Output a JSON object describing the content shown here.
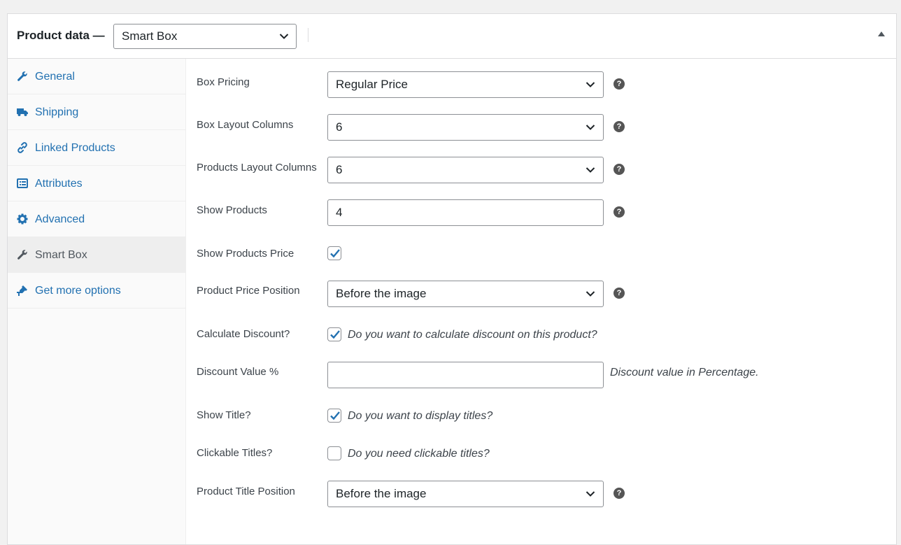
{
  "header": {
    "title": "Product data —",
    "product_type": "Smart Box"
  },
  "sidebar": {
    "items": [
      {
        "label": "General",
        "icon": "wrench-icon"
      },
      {
        "label": "Shipping",
        "icon": "truck-icon"
      },
      {
        "label": "Linked Products",
        "icon": "link-icon"
      },
      {
        "label": "Attributes",
        "icon": "list-icon"
      },
      {
        "label": "Advanced",
        "icon": "gear-icon"
      },
      {
        "label": "Smart Box",
        "icon": "wrench-icon"
      },
      {
        "label": "Get more options",
        "icon": "plugin-icon"
      }
    ],
    "active_index": 5
  },
  "fields": {
    "box_pricing": {
      "label": "Box Pricing",
      "value": "Regular Price"
    },
    "box_layout_columns": {
      "label": "Box Layout Columns",
      "value": "6"
    },
    "products_layout_columns": {
      "label": "Products Layout Columns",
      "value": "6"
    },
    "show_products": {
      "label": "Show Products",
      "value": "4"
    },
    "show_products_price": {
      "label": "Show Products Price",
      "checked": true
    },
    "product_price_position": {
      "label": "Product Price Position",
      "value": "Before the image"
    },
    "calculate_discount": {
      "label": "Calculate Discount?",
      "checked": true,
      "description": "Do you want to calculate discount on this product?"
    },
    "discount_value": {
      "label": "Discount Value %",
      "value": "",
      "description": "Discount value in Percentage."
    },
    "show_title": {
      "label": "Show Title?",
      "checked": true,
      "description": "Do you want to display titles?"
    },
    "clickable_titles": {
      "label": "Clickable Titles?",
      "checked": false,
      "description": "Do you need clickable titles?"
    },
    "product_title_position": {
      "label": "Product Title Position",
      "value": "Before the image"
    }
  },
  "help_glyph": "?",
  "colors": {
    "link": "#2271b1",
    "checkmark": "#2271b1",
    "active_bg": "#eeeeee"
  }
}
